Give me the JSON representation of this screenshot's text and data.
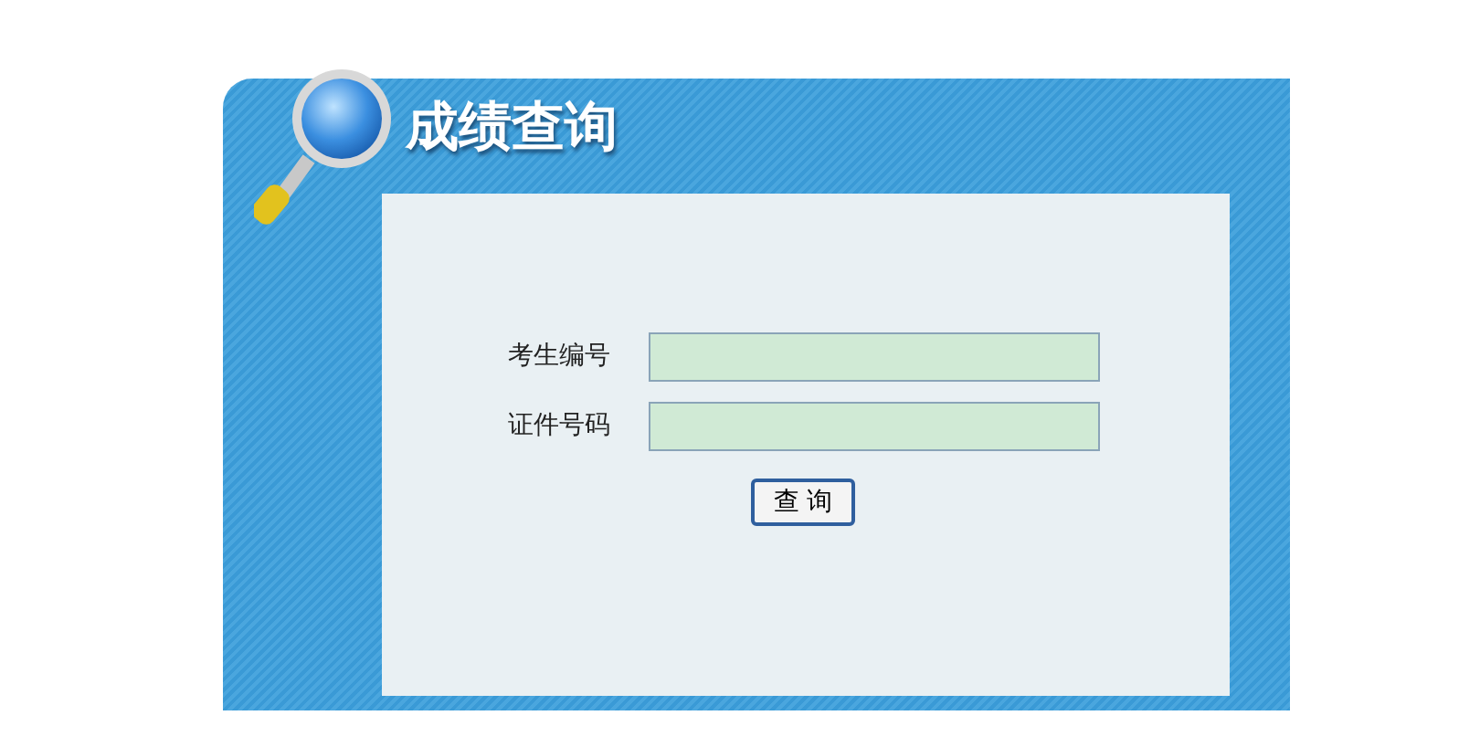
{
  "title": "成绩查询",
  "fields": [
    {
      "label": "考生编号"
    },
    {
      "label": "证件号码"
    }
  ],
  "button": "查 询"
}
